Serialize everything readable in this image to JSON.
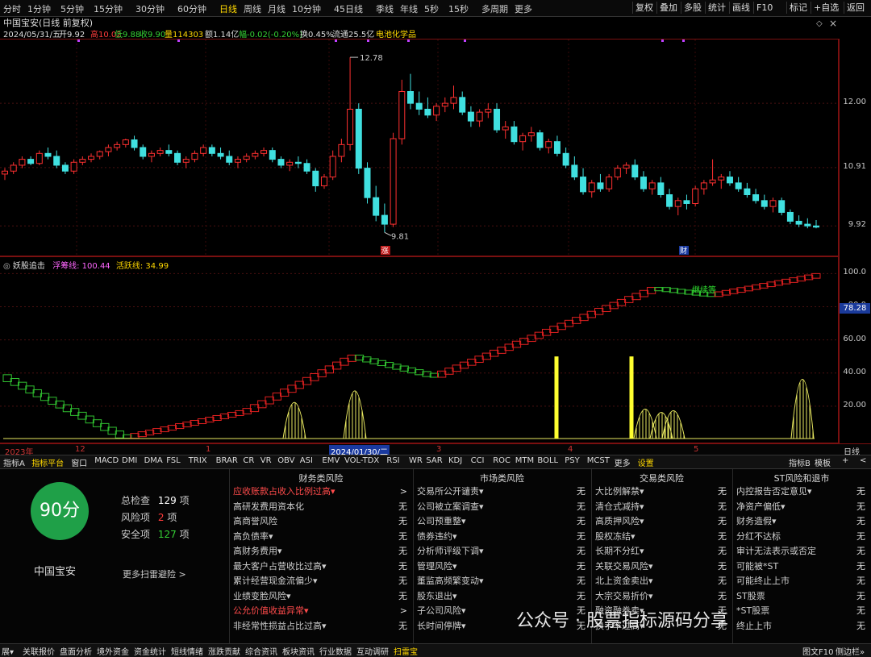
{
  "toolbar": {
    "timeframes": [
      "分时",
      "1分钟",
      "5分钟",
      "15分钟",
      "30分钟",
      "60分钟",
      "日线",
      "周线",
      "月线",
      "10分钟",
      "45日线",
      "季线",
      "年线",
      "5秒",
      "15秒",
      "多周期",
      "更多"
    ],
    "active_index": 6,
    "right_buttons": [
      "复权",
      "叠加",
      "多股",
      "统计",
      "画线",
      "F10",
      "标记",
      "+自选",
      "返回"
    ]
  },
  "info": {
    "title": "中国宝安(日线 前复权)",
    "date": "2024/05/31/五",
    "open": "开9.92",
    "high": "高10.02",
    "low": "低9.88",
    "close": "收9.90",
    "volume": "量114303",
    "amount": "额1.14亿",
    "change": "幅-0.02(-0.20%)",
    "turnover": "换0.45%",
    "float": "流通25.5亿",
    "sector": "电池化学品"
  },
  "price_chart": {
    "y_labels": [
      "12.00",
      "10.91",
      "9.92"
    ],
    "y_values": [
      12.0,
      10.91,
      9.92
    ],
    "ylim": [
      9.5,
      13.0
    ],
    "high_mark": "12.78",
    "low_mark": "9.81",
    "marker_zhang": "涨",
    "marker_cai": "财",
    "candles": [
      [
        10.8,
        10.9,
        10.7,
        10.85
      ],
      [
        10.85,
        11.0,
        10.8,
        10.95
      ],
      [
        10.95,
        11.1,
        10.9,
        11.05
      ],
      [
        11.05,
        11.1,
        10.95,
        10.98
      ],
      [
        10.98,
        11.2,
        10.95,
        11.15
      ],
      [
        11.15,
        11.25,
        11.05,
        11.1
      ],
      [
        11.1,
        11.2,
        10.9,
        10.95
      ],
      [
        10.95,
        11.0,
        10.8,
        10.85
      ],
      [
        10.85,
        11.05,
        10.8,
        11.0
      ],
      [
        11.0,
        11.1,
        10.95,
        11.05
      ],
      [
        11.05,
        11.15,
        11.0,
        11.1
      ],
      [
        11.1,
        11.2,
        11.05,
        11.18
      ],
      [
        11.18,
        11.3,
        11.1,
        11.25
      ],
      [
        11.25,
        11.35,
        11.2,
        11.3
      ],
      [
        11.3,
        11.4,
        11.25,
        11.38
      ],
      [
        11.38,
        11.45,
        11.2,
        11.25
      ],
      [
        11.25,
        11.3,
        11.05,
        11.1
      ],
      [
        11.1,
        11.2,
        11.0,
        11.15
      ],
      [
        11.15,
        11.25,
        11.1,
        11.2
      ],
      [
        11.2,
        11.3,
        11.1,
        11.15
      ],
      [
        11.15,
        11.2,
        10.95,
        11.0
      ],
      [
        11.0,
        11.1,
        10.9,
        11.05
      ],
      [
        11.05,
        11.2,
        11.0,
        11.15
      ],
      [
        11.15,
        11.3,
        11.1,
        11.25
      ],
      [
        11.25,
        11.3,
        11.1,
        11.15
      ],
      [
        11.15,
        11.25,
        11.05,
        11.1
      ],
      [
        11.1,
        11.2,
        10.95,
        11.0
      ],
      [
        11.0,
        11.1,
        10.9,
        11.05
      ],
      [
        11.05,
        11.15,
        11.0,
        11.1
      ],
      [
        11.1,
        11.2,
        11.05,
        11.15
      ],
      [
        11.15,
        11.25,
        11.1,
        11.2
      ],
      [
        11.2,
        11.25,
        11.0,
        11.05
      ],
      [
        11.05,
        11.1,
        10.9,
        10.95
      ],
      [
        10.95,
        11.05,
        10.85,
        11.0
      ],
      [
        11.0,
        11.1,
        10.9,
        10.98
      ],
      [
        10.98,
        11.05,
        10.8,
        10.85
      ],
      [
        10.85,
        10.9,
        10.5,
        10.6
      ],
      [
        10.6,
        10.8,
        10.55,
        10.75
      ],
      [
        10.75,
        11.2,
        10.7,
        11.1
      ],
      [
        11.1,
        11.4,
        11.0,
        11.3
      ],
      [
        11.3,
        12.78,
        11.2,
        11.9
      ],
      [
        11.9,
        12.0,
        10.8,
        10.9
      ],
      [
        10.9,
        11.0,
        10.3,
        10.4
      ],
      [
        10.4,
        10.6,
        10.0,
        10.1
      ],
      [
        10.1,
        10.3,
        9.81,
        9.95
      ],
      [
        9.95,
        11.5,
        9.9,
        11.4
      ],
      [
        11.4,
        12.4,
        11.3,
        12.2
      ],
      [
        12.2,
        12.5,
        11.9,
        12.0
      ],
      [
        12.0,
        12.2,
        11.8,
        11.9
      ],
      [
        11.9,
        12.1,
        11.75,
        11.8
      ],
      [
        11.8,
        12.0,
        11.7,
        11.95
      ],
      [
        11.95,
        12.1,
        11.85,
        12.0
      ],
      [
        12.0,
        12.3,
        11.9,
        12.1
      ],
      [
        12.1,
        12.2,
        11.8,
        11.85
      ],
      [
        11.85,
        11.95,
        11.6,
        11.7
      ],
      [
        11.7,
        11.9,
        11.6,
        11.85
      ],
      [
        11.85,
        12.0,
        11.75,
        11.9
      ],
      [
        11.9,
        12.0,
        11.5,
        11.55
      ],
      [
        11.55,
        11.7,
        11.4,
        11.6
      ],
      [
        11.6,
        11.7,
        11.3,
        11.35
      ],
      [
        11.35,
        11.5,
        11.2,
        11.45
      ],
      [
        11.45,
        11.6,
        11.35,
        11.5
      ],
      [
        11.5,
        11.55,
        11.2,
        11.25
      ],
      [
        11.25,
        11.4,
        11.15,
        11.35
      ],
      [
        11.35,
        11.45,
        11.1,
        11.15
      ],
      [
        11.15,
        11.25,
        10.9,
        10.95
      ],
      [
        10.95,
        11.1,
        10.7,
        10.75
      ],
      [
        10.75,
        10.9,
        10.45,
        10.5
      ],
      [
        10.5,
        10.7,
        10.4,
        10.65
      ],
      [
        10.65,
        10.8,
        10.5,
        10.55
      ],
      [
        10.55,
        10.8,
        10.5,
        10.75
      ],
      [
        10.75,
        10.95,
        10.7,
        10.9
      ],
      [
        10.9,
        11.0,
        10.8,
        10.95
      ],
      [
        10.95,
        11.05,
        10.7,
        10.75
      ],
      [
        10.75,
        10.85,
        10.5,
        10.55
      ],
      [
        10.55,
        10.7,
        10.45,
        10.65
      ],
      [
        10.65,
        10.75,
        10.4,
        10.45
      ],
      [
        10.45,
        10.55,
        10.2,
        10.25
      ],
      [
        10.25,
        10.4,
        10.1,
        10.35
      ],
      [
        10.35,
        10.45,
        10.2,
        10.3
      ],
      [
        10.3,
        10.6,
        10.25,
        10.55
      ],
      [
        10.55,
        10.7,
        10.45,
        10.65
      ],
      [
        10.65,
        11.05,
        10.6,
        10.7
      ],
      [
        10.7,
        10.8,
        10.55,
        10.75
      ],
      [
        10.75,
        10.85,
        10.6,
        10.65
      ],
      [
        10.65,
        10.75,
        10.5,
        10.55
      ],
      [
        10.55,
        10.65,
        10.4,
        10.45
      ],
      [
        10.45,
        10.55,
        10.3,
        10.35
      ],
      [
        10.35,
        10.45,
        10.2,
        10.25
      ],
      [
        10.25,
        10.4,
        10.15,
        10.35
      ],
      [
        10.35,
        10.4,
        10.1,
        10.15
      ],
      [
        10.15,
        10.2,
        9.95,
        10.0
      ],
      [
        10.0,
        10.1,
        9.9,
        9.95
      ],
      [
        9.95,
        10.05,
        9.88,
        9.92
      ],
      [
        9.92,
        10.02,
        9.88,
        9.9
      ]
    ]
  },
  "indicator": {
    "name": "妖股追击",
    "l1_label": "浮筹线:",
    "l1_value": "100.44",
    "l2_label": "活跃线:",
    "l2_value": "34.99",
    "y_labels": [
      "100.0",
      "80.0",
      "60.00",
      "40.00",
      "20.00"
    ],
    "y_values": [
      100,
      80,
      60,
      40,
      20
    ],
    "current": "78.28",
    "annotation": "继续等",
    "ylim": [
      0,
      106
    ]
  },
  "date_axis": [
    "2023年",
    "12",
    "1",
    "2024/01/30/二",
    "3",
    "4",
    "5",
    "日线"
  ],
  "tabs": [
    "指标A",
    "指标平台",
    "窗口",
    "MACD",
    "DMI",
    "DMA",
    "FSL",
    "TRIX",
    "BRAR",
    "CR",
    "VR",
    "OBV",
    "ASI",
    "EMV",
    "VOL-TDX",
    "RSI",
    "WR",
    "SAR",
    "KDJ",
    "CCI",
    "ROC",
    "MTM",
    "BOLL",
    "PSY",
    "MCST",
    "更多",
    "设置"
  ],
  "tabs_right": [
    "指标B",
    "模板",
    "+",
    "<"
  ],
  "risk": {
    "score": "90分",
    "name": "中国宝安",
    "total_label": "总检查",
    "total_value": "129",
    "total_unit": "项",
    "risk_label": "风险项",
    "risk_value": "2",
    "risk_unit": "项",
    "safe_label": "安全项",
    "safe_value": "127",
    "safe_unit": "项",
    "more": "更多扫雷避险 >",
    "columns": [
      {
        "title": "财务类风险",
        "rows": [
          {
            "label": "应收账款占收入比例过高▾",
            "value": ">",
            "warn": true
          },
          {
            "label": "高研发费用资本化",
            "value": "无",
            "warn": false
          },
          {
            "label": "高商誉风险",
            "value": "无",
            "warn": false
          },
          {
            "label": "高负债率▾",
            "value": "无",
            "warn": false
          },
          {
            "label": "高财务费用▾",
            "value": "无",
            "warn": false
          },
          {
            "label": "最大客户占营收比过高▾",
            "value": "无",
            "warn": false
          },
          {
            "label": "累计经营现金流偏少▾",
            "value": "无",
            "warn": false
          },
          {
            "label": "业绩变脸风险▾",
            "value": "无",
            "warn": false
          },
          {
            "label": "公允价值收益异常▾",
            "value": ">",
            "warn": true
          },
          {
            "label": "非经常性损益占比过高▾",
            "value": "无",
            "warn": false
          }
        ]
      },
      {
        "title": "市场类风险",
        "rows": [
          {
            "label": "交易所公开谴责▾",
            "value": "无",
            "warn": false
          },
          {
            "label": "公司被立案调查▾",
            "value": "无",
            "warn": false
          },
          {
            "label": "公司预重整▾",
            "value": "无",
            "warn": false
          },
          {
            "label": "债券违约▾",
            "value": "无",
            "warn": false
          },
          {
            "label": "分析师评级下调▾",
            "value": "无",
            "warn": false
          },
          {
            "label": "管理风险▾",
            "value": "无",
            "warn": false
          },
          {
            "label": "董监高频繁变动▾",
            "value": "无",
            "warn": false
          },
          {
            "label": "股东退出▾",
            "value": "无",
            "warn": false
          },
          {
            "label": "子公司风险▾",
            "value": "无",
            "warn": false
          },
          {
            "label": "长时间停牌▾",
            "value": "无",
            "warn": false
          }
        ]
      },
      {
        "title": "交易类风险",
        "rows": [
          {
            "label": "大比例解禁▾",
            "value": "无",
            "warn": false
          },
          {
            "label": "清仓式减持▾",
            "value": "无",
            "warn": false
          },
          {
            "label": "高质押风险▾",
            "value": "无",
            "warn": false
          },
          {
            "label": "股权冻结▾",
            "value": "无",
            "warn": false
          },
          {
            "label": "长期不分红▾",
            "value": "无",
            "warn": false
          },
          {
            "label": "关联交易风险▾",
            "value": "无",
            "warn": false
          },
          {
            "label": "北上资金卖出▾",
            "value": "无",
            "warn": false
          },
          {
            "label": "大宗交易折价▾",
            "value": "无",
            "warn": false
          },
          {
            "label": "融资融券卖▾",
            "value": "无",
            "warn": false
          },
          {
            "label": "换手率过高▾",
            "value": "无",
            "warn": false
          }
        ]
      },
      {
        "title": "ST风险和退市",
        "rows": [
          {
            "label": "内控报告否定意见▾",
            "value": "无",
            "warn": false
          },
          {
            "label": "净资产偏低▾",
            "value": "无",
            "warn": false
          },
          {
            "label": "财务造假▾",
            "value": "无",
            "warn": false
          },
          {
            "label": "分红不达标",
            "value": "无",
            "warn": false
          },
          {
            "label": "审计无法表示或否定",
            "value": "无",
            "warn": false
          },
          {
            "label": "可能被*ST",
            "value": "无",
            "warn": false
          },
          {
            "label": "可能终止上市",
            "value": "无",
            "warn": false
          },
          {
            "label": "ST股票",
            "value": "无",
            "warn": false
          },
          {
            "label": "*ST股票",
            "value": "无",
            "warn": false
          },
          {
            "label": "终止上市",
            "value": "无",
            "warn": false
          }
        ]
      }
    ]
  },
  "watermark": "公众号 · 股票指标源码分享",
  "bottom_tabs": [
    "展▾",
    "关联报价",
    "盘面分析",
    "境外资金",
    "资金统计",
    "短线情绪",
    "涨跌贡献",
    "综合资讯",
    "板块资讯",
    "行业数据",
    "互动调研",
    "扫雷宝"
  ],
  "bottom_right": [
    "图文F10",
    "侧边栏»"
  ],
  "colors": {
    "up": "#ff3030",
    "down": "#40e0e0",
    "accent": "#ffd800",
    "score": "#1fa048"
  }
}
